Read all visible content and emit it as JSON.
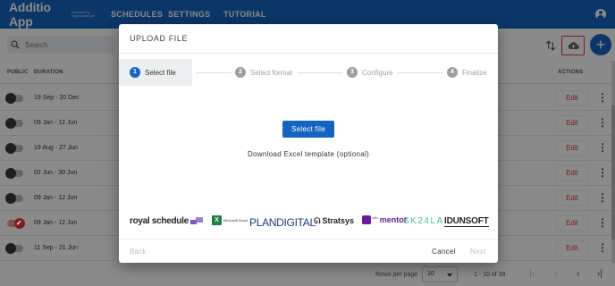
{
  "app": {
    "brand": "Additio App",
    "brand_sub": "powered by royal schedule",
    "nav": [
      "SCHEDULES",
      "SETTINGS",
      "TUTORIAL"
    ]
  },
  "toolbar": {
    "search_placeholder": "Search"
  },
  "table": {
    "headers": {
      "public": "PUBLIC",
      "duration": "DURATION",
      "actions": "ACTIONS"
    },
    "rows": [
      {
        "public": false,
        "duration": "19 Sep - 20 Dec",
        "action": "Edit"
      },
      {
        "public": false,
        "duration": "09 Jan - 12 Jun",
        "action": "Edit"
      },
      {
        "public": false,
        "duration": "19 Aug - 27 Jun",
        "action": "Edit"
      },
      {
        "public": false,
        "duration": "02 Jun - 30 Jun",
        "action": "Edit"
      },
      {
        "public": false,
        "duration": "09 Jan - 12 Jun",
        "action": "Edit"
      },
      {
        "public": true,
        "duration": "09 Jan - 12 Jun",
        "action": "Edit"
      },
      {
        "public": false,
        "duration": "11 Sep - 21 Jun",
        "action": "Edit"
      }
    ]
  },
  "pagination": {
    "rows_per_page_label": "Rows per page",
    "rows_per_page": "10",
    "range": "1 - 10 of 38"
  },
  "modal": {
    "title": "UPLOAD FILE",
    "steps": [
      {
        "num": "1",
        "label": "Select file"
      },
      {
        "num": "2",
        "label": "Select format"
      },
      {
        "num": "3",
        "label": "Configure"
      },
      {
        "num": "4",
        "label": "Finalize"
      }
    ],
    "active_step": 1,
    "select_file_button": "Select file",
    "template_link": "Download Excel template (optional)",
    "logos": {
      "royal_schedule": "royal schedule",
      "microsoft_excel": "Microsoft Excel",
      "plandigital": "PLANDIGITAL",
      "stratsys": "Stratsys",
      "mentor_sub": "edu",
      "mentor": "mentor",
      "skola": "SK24LA",
      "idunsoft": "IDUNSOFT"
    },
    "back_button": "Back",
    "cancel_button": "Cancel",
    "next_button": "Next"
  },
  "colors": {
    "primary": "#1565c0",
    "danger": "#e53935",
    "overlay": "rgba(0,0,0,0.46)"
  },
  "icons": [
    "search-icon",
    "sort-icon",
    "cloud-upload-icon",
    "add-icon",
    "account-icon",
    "more-vert-icon",
    "first-page-icon",
    "prev-page-icon",
    "next-page-icon",
    "last-page-icon"
  ]
}
